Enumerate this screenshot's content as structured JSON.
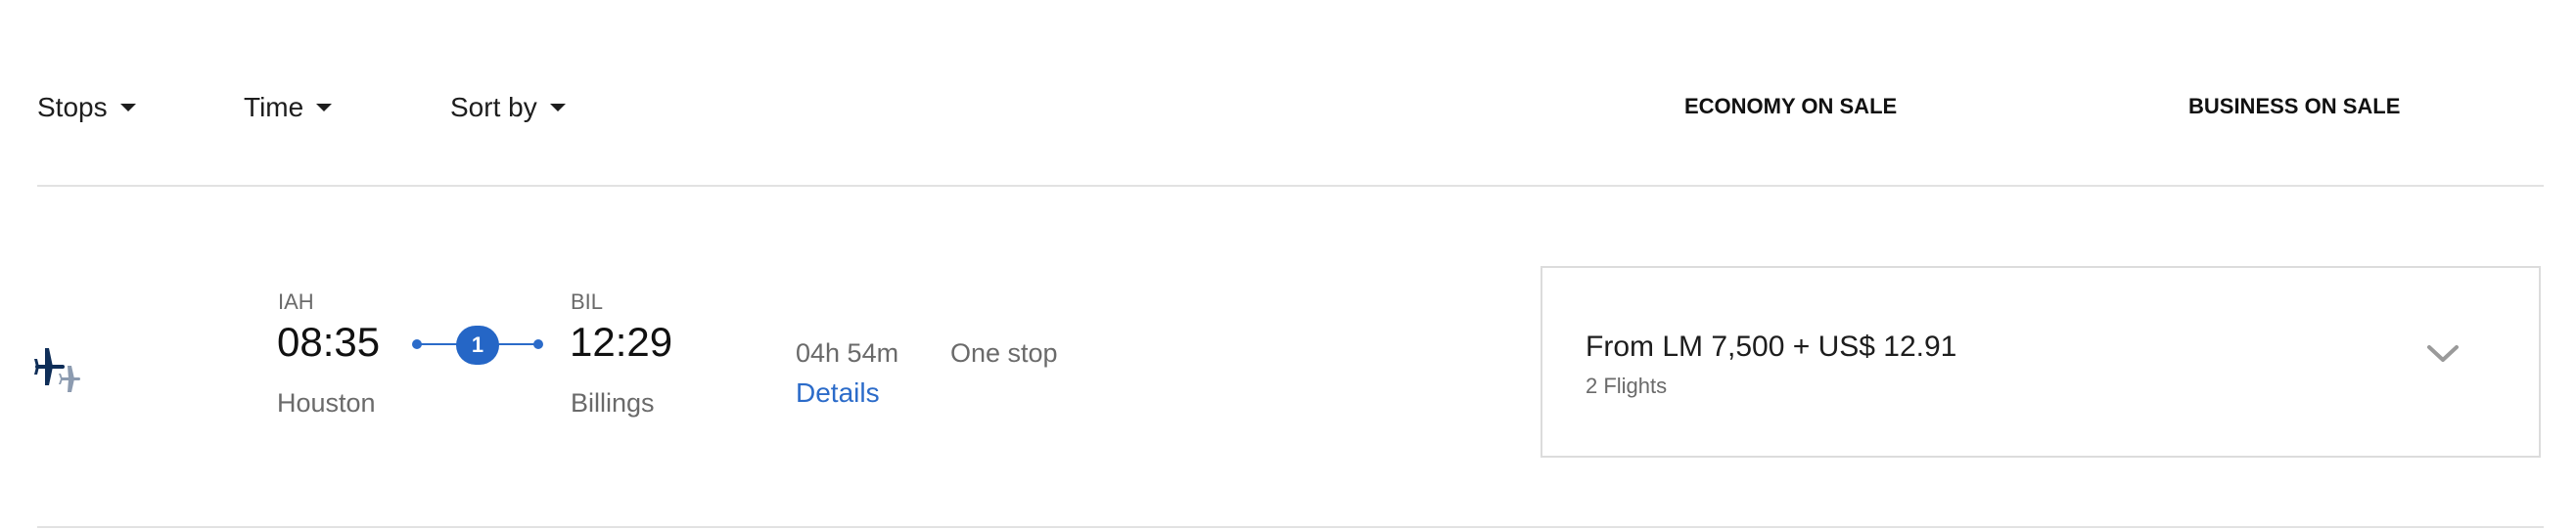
{
  "filters": {
    "stops_label": "Stops",
    "time_label": "Time",
    "sort_label": "Sort by"
  },
  "cabins": {
    "economy": "ECONOMY ON SALE",
    "business": "BUSINESS ON SALE"
  },
  "flight": {
    "airline_icon": "airplane-logo-icon",
    "origin": {
      "code": "IAH",
      "time": "08:35",
      "city": "Houston"
    },
    "destination": {
      "code": "BIL",
      "time": "12:29",
      "city": "Billings"
    },
    "stop_count": "1",
    "duration": "04h 54m",
    "stops_text": "One stop",
    "details_label": "Details",
    "price": {
      "text": "From LM 7,500 + US$ 12.91",
      "flights_count": "2 Flights",
      "expand_icon": "chevron-down-icon"
    }
  },
  "colors": {
    "accent": "#2b6bc9",
    "badge": "#2566c6",
    "logo_primary": "#0f2e58",
    "logo_secondary": "#8c9bb0"
  }
}
